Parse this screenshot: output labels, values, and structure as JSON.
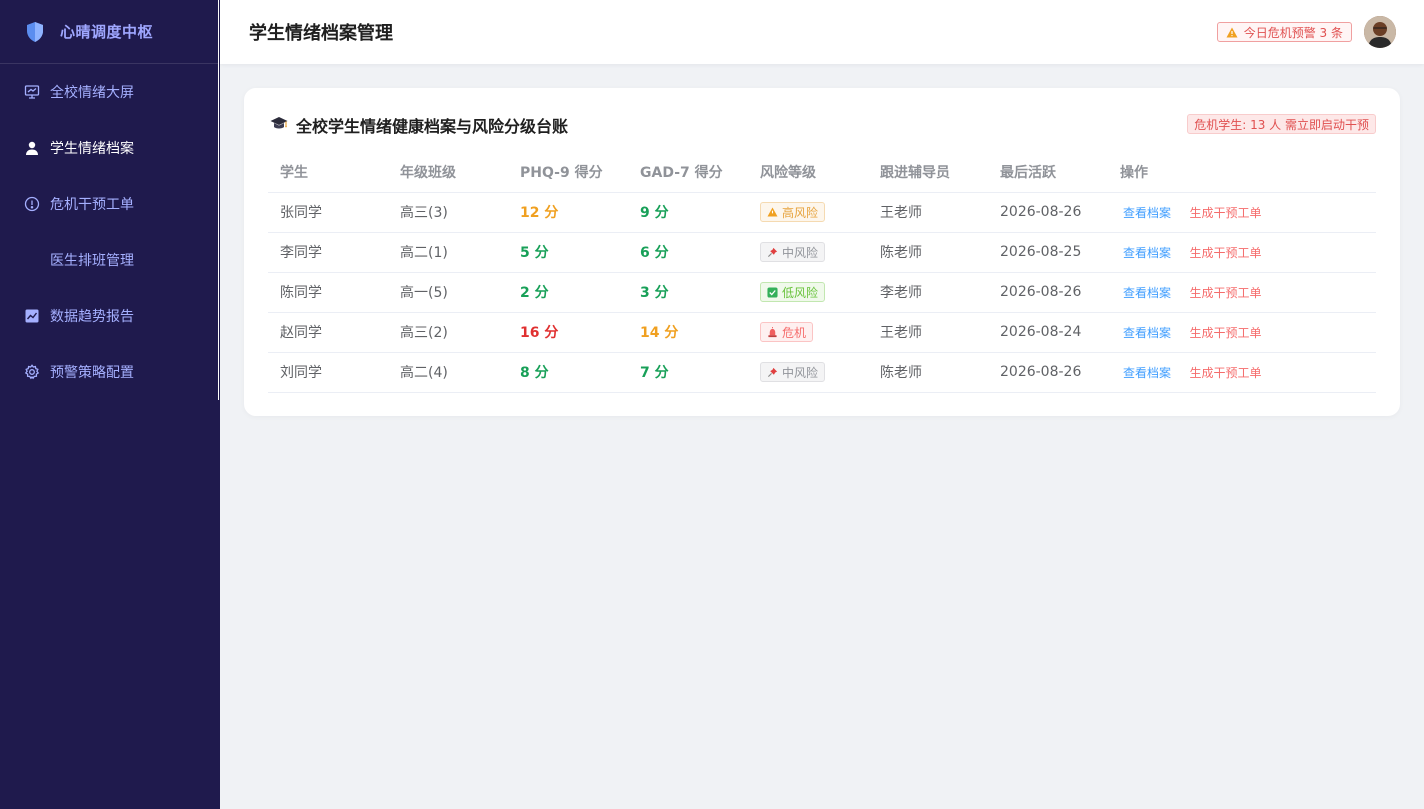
{
  "sidebar": {
    "brand": "心晴调度中枢",
    "items": [
      {
        "label": "全校情绪大屏",
        "icon": "presentation-icon",
        "active": false
      },
      {
        "label": "学生情绪档案",
        "icon": "user-icon",
        "active": true
      },
      {
        "label": "危机干预工单",
        "icon": "alert-circle-icon",
        "active": false
      },
      {
        "label": "医生排班管理",
        "icon": "",
        "active": false
      },
      {
        "label": "数据趋势报告",
        "icon": "chart-icon",
        "active": false
      },
      {
        "label": "预警策略配置",
        "icon": "gear-icon",
        "active": false
      }
    ]
  },
  "header": {
    "title": "学生情绪档案管理",
    "alert_text": "今日危机预警 3 条"
  },
  "card": {
    "title": "全校学生情绪健康档案与风险分级台账",
    "crisis_tag": "危机学生: 13 人 需立即启动干预",
    "columns": [
      "学生",
      "年级班级",
      "PHQ-9 得分",
      "GAD-7 得分",
      "风险等级",
      "跟进辅导员",
      "最后活跃",
      "操作"
    ],
    "rows": [
      {
        "name": "张同学",
        "class": "高三(3)",
        "phq": "12 分",
        "gad": "9 分",
        "risk": "高风险",
        "counselor": "王老师",
        "last": "2026-08-26",
        "view": "查看档案",
        "gen": "生成干预工单"
      },
      {
        "name": "李同学",
        "class": "高二(1)",
        "phq": "5 分",
        "gad": "6 分",
        "risk": "中风险",
        "counselor": "陈老师",
        "last": "2026-08-25",
        "view": "查看档案",
        "gen": "生成干预工单"
      },
      {
        "name": "陈同学",
        "class": "高一(5)",
        "phq": "2 分",
        "gad": "3 分",
        "risk": "低风险",
        "counselor": "李老师",
        "last": "2026-08-26",
        "view": "查看档案",
        "gen": "生成干预工单"
      },
      {
        "name": "赵同学",
        "class": "高三(2)",
        "phq": "16 分",
        "gad": "14 分",
        "risk": "危机",
        "counselor": "王老师",
        "last": "2026-08-24",
        "view": "查看档案",
        "gen": "生成干预工单"
      },
      {
        "name": "刘同学",
        "class": "高二(4)",
        "phq": "8 分",
        "gad": "7 分",
        "risk": "中风险",
        "counselor": "陈老师",
        "last": "2026-08-26",
        "view": "查看档案",
        "gen": "生成干预工单"
      }
    ]
  },
  "colors": {
    "sidebar_bg": "#1f1a4d",
    "accent": "#9fa7ff",
    "danger": "#e05050",
    "success": "#18a058",
    "warning": "#f0a020"
  }
}
